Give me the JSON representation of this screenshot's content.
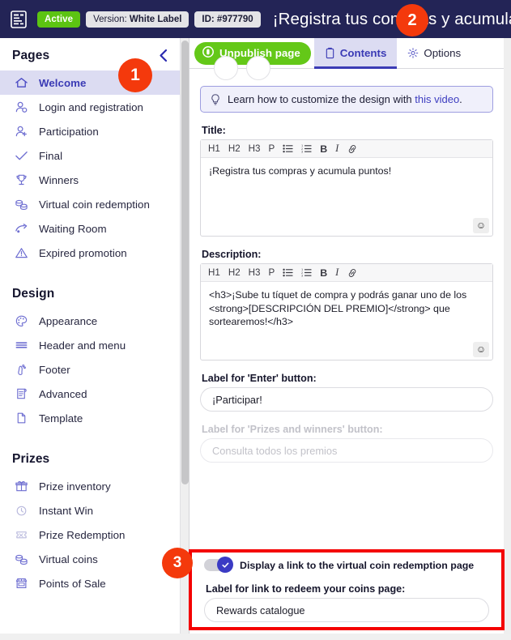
{
  "header": {
    "logo_icon": "ticket-icon",
    "status_badge": "Active",
    "version_prefix": "Version: ",
    "version_value": "White Label",
    "id_badge": "ID: #977790",
    "page_title": "¡Registra tus compras y acumula"
  },
  "sidebar": {
    "collapse_icon": "chevron-left-icon",
    "sections": [
      {
        "title": "Pages",
        "items": [
          {
            "label": "Welcome",
            "icon": "home-icon",
            "selected": true
          },
          {
            "label": "Login and registration",
            "icon": "user-login-icon",
            "selected": false
          },
          {
            "label": "Participation",
            "icon": "user-add-icon",
            "selected": false
          },
          {
            "label": "Final",
            "icon": "check-icon",
            "selected": false
          },
          {
            "label": "Winners",
            "icon": "trophy-icon",
            "selected": false
          },
          {
            "label": "Virtual coin redemption",
            "icon": "coins-icon",
            "selected": false
          },
          {
            "label": "Waiting Room",
            "icon": "waiting-room-icon",
            "selected": false
          },
          {
            "label": "Expired promotion",
            "icon": "warning-triangle-icon",
            "selected": false
          }
        ]
      },
      {
        "title": "Design",
        "items": [
          {
            "label": "Appearance",
            "icon": "palette-icon",
            "selected": false
          },
          {
            "label": "Header and menu",
            "icon": "menu-lines-icon",
            "selected": false
          },
          {
            "label": "Footer",
            "icon": "footprint-icon",
            "selected": false
          },
          {
            "label": "Advanced",
            "icon": "scroll-document-icon",
            "selected": false
          },
          {
            "label": "Template",
            "icon": "page-icon",
            "selected": false
          }
        ]
      },
      {
        "title": "Prizes",
        "items": [
          {
            "label": "Prize inventory",
            "icon": "gift-icon",
            "selected": false
          },
          {
            "label": "Instant Win",
            "icon": "stopwatch-icon",
            "selected": false,
            "dim": true
          },
          {
            "label": "Prize Redemption",
            "icon": "ticket-stub-icon",
            "selected": false,
            "dim": true
          },
          {
            "label": "Virtual coins",
            "icon": "coins-icon",
            "selected": false
          },
          {
            "label": "Points of Sale",
            "icon": "store-icon",
            "selected": false
          }
        ]
      }
    ]
  },
  "panel": {
    "unpublish_label": "Unpublish page",
    "unpublish_icon": "unpublish-icon",
    "tabs": [
      {
        "label": "Contents",
        "icon": "clipboard-icon",
        "active": true
      },
      {
        "label": "Options",
        "icon": "gear-icon",
        "active": false
      }
    ],
    "tip": {
      "icon": "lightbulb-icon",
      "text": "Learn how to customize the design with ",
      "link_text": "this video",
      "suffix": "."
    },
    "editor_toolbar": [
      "H1",
      "H2",
      "H3",
      "P",
      "bulleted-list-icon",
      "numbered-list-icon",
      "B",
      "I",
      "link-icon"
    ],
    "title_field": {
      "label": "Title:",
      "value": "¡Registra tus compras y acumula puntos!",
      "emoji_icon": "emoji-icon"
    },
    "description_field": {
      "label": "Description:",
      "value": "<h3>¡Sube tu tíquet de compra y podrás ganar uno de los <strong>[DESCRIPCIÓN DEL PREMIO]</strong> que sortearemos!</h3>",
      "emoji_icon": "emoji-icon"
    },
    "enter_button_field": {
      "label": "Label for 'Enter' button:",
      "value": "¡Participar!"
    },
    "prizes_button_field": {
      "label": "Label for 'Prizes and winners' button:",
      "placeholder": "Consulta todos los premios",
      "disabled": true
    },
    "coin_link_toggle": {
      "label": "Display a link to the virtual coin redemption page",
      "state": "on",
      "check_icon": "check-icon"
    },
    "coin_link_field": {
      "label": "Label for link to redeem your coins page:",
      "value": "Rewards catalogue"
    }
  },
  "markers": [
    {
      "id": "1",
      "text": "1"
    },
    {
      "id": "2",
      "text": "2"
    },
    {
      "id": "3",
      "text": "3"
    }
  ],
  "colors": {
    "header_bg": "#232456",
    "accent_blue": "#3b3bb5",
    "active_green": "#5cc412",
    "marker_orange": "#f4390c",
    "highlight_red": "#f40000"
  }
}
